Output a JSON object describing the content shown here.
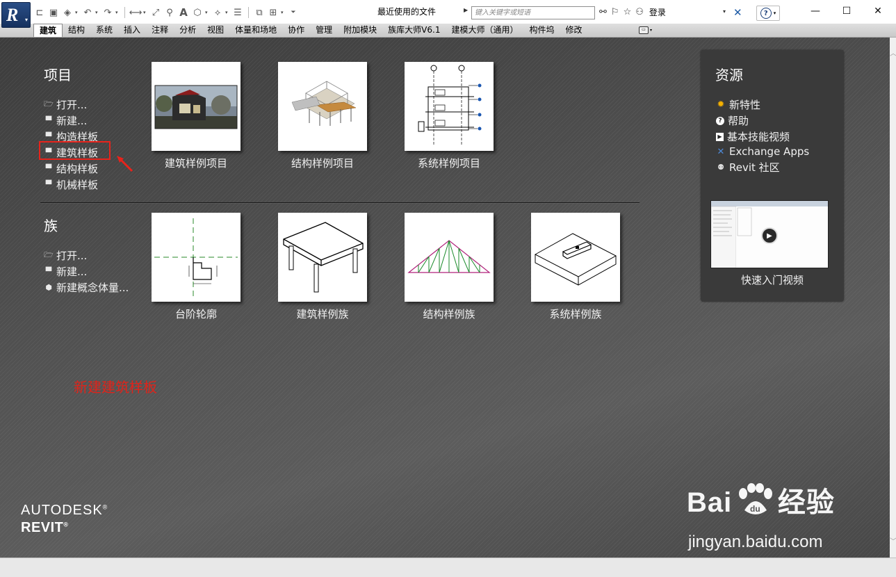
{
  "title_bar": {
    "app_menu_icon": "revit-r-logo",
    "recent_files_title": "最近使用的文件",
    "search_placeholder": "键入关键字或短语",
    "login_label": "登录",
    "help_icon": "help-question-icon",
    "window_controls": [
      "minimize-icon",
      "maximize-icon",
      "close-icon"
    ]
  },
  "quick_access": {
    "icons": [
      "open-icon",
      "save-icon",
      "sync-icon",
      "undo-icon",
      "redo-icon",
      "measure-icon",
      "dimension-icon",
      "tag-icon",
      "text-icon",
      "3d-view-icon",
      "section-icon",
      "thin-lines-icon",
      "close-hidden-icon",
      "switch-windows-icon",
      "customize-icon"
    ]
  },
  "ribbon_tabs": [
    "建筑",
    "结构",
    "系统",
    "插入",
    "注释",
    "分析",
    "视图",
    "体量和场地",
    "协作",
    "管理",
    "附加模块",
    "族库大师V6.1",
    "建模大师（通用）",
    "构件坞",
    "修改"
  ],
  "active_tab": "建筑",
  "projects": {
    "title": "项目",
    "links": [
      {
        "label": "打开...",
        "icon": "folder-open-icon"
      },
      {
        "label": "新建...",
        "icon": "new-file-icon"
      },
      {
        "label": "构造样板",
        "icon": "new-file-icon"
      },
      {
        "label": "建筑样板",
        "icon": "new-file-icon"
      },
      {
        "label": "结构样板",
        "icon": "new-file-icon"
      },
      {
        "label": "机械样板",
        "icon": "new-file-icon"
      }
    ],
    "thumbnails": [
      {
        "caption": "建筑样例项目",
        "icon": "rendered-house-thumbnail"
      },
      {
        "caption": "结构样例项目",
        "icon": "structural-model-thumbnail"
      },
      {
        "caption": "系统样例项目",
        "icon": "mep-section-thumbnail"
      }
    ]
  },
  "families": {
    "title": "族",
    "links": [
      {
        "label": "打开...",
        "icon": "folder-open-icon"
      },
      {
        "label": "新建...",
        "icon": "new-file-icon"
      },
      {
        "label": "新建概念体量...",
        "icon": "mass-icon"
      }
    ],
    "thumbnails": [
      {
        "caption": "台阶轮廓",
        "icon": "stair-profile-thumbnail"
      },
      {
        "caption": "建筑样例族",
        "icon": "table-family-thumbnail"
      },
      {
        "caption": "结构样例族",
        "icon": "truss-family-thumbnail"
      },
      {
        "caption": "系统样例族",
        "icon": "duct-family-thumbnail"
      }
    ]
  },
  "resources": {
    "title": "资源",
    "links": [
      {
        "label": "新特性",
        "icon": "sun-icon"
      },
      {
        "label": "帮助",
        "icon": "help-icon"
      },
      {
        "label": "基本技能视频",
        "icon": "video-icon"
      },
      {
        "label": "Exchange Apps",
        "icon": "exchange-icon"
      },
      {
        "label": "Revit 社区",
        "icon": "community-icon"
      }
    ],
    "video_caption": "快速入门视频"
  },
  "annotation": {
    "text": "新建建筑样板",
    "color": "#e0231a"
  },
  "branding": {
    "line1": "AUTODESK",
    "line2": "REVIT",
    "registered": "®"
  },
  "watermark": {
    "brand": "Bai",
    "brand_suffix": "经验",
    "url": "jingyan.baidu.com"
  },
  "colors": {
    "accent_red": "#e8231b",
    "panel_bg": "#3a3a3a",
    "app_blue": "#1a3e78"
  }
}
